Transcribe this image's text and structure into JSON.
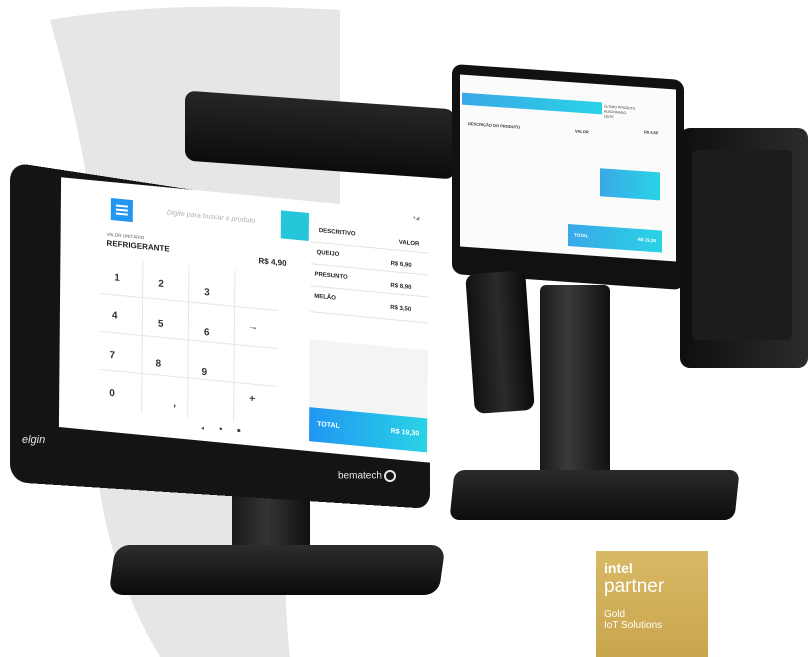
{
  "front_screen": {
    "search_placeholder": "Digite para buscar o produto",
    "unit_value_label": "VALOR UNITÁRIO",
    "product_name": "REFRIGERANTE",
    "product_price": "R$ 4,90",
    "keypad": [
      "1",
      "2",
      "3",
      "4",
      "5",
      "6",
      "7",
      "8",
      "9",
      "0",
      ",",
      "+",
      "→"
    ],
    "columns": {
      "description": "DESCRITIVO",
      "value": "VALOR"
    },
    "items": [
      {
        "name": "QUEIJO",
        "value": "R$ 6,90"
      },
      {
        "name": "PRESUNTO",
        "value": "R$ 8,90"
      },
      {
        "name": "MELÃO",
        "value": "R$ 3,50"
      }
    ],
    "total_label": "TOTAL",
    "total_value": "R$ 19,30",
    "nav": {
      "back": "◂",
      "home": "●",
      "recent": "■"
    }
  },
  "brands": {
    "front_left": "elgin",
    "front_right": "bematech"
  },
  "rear_screen": {
    "header": "DESCRIÇÃO DO PRODUTO",
    "value_header": "VALOR",
    "side_label_1": "ÚLTIMO PRODUTO",
    "side_label_2": "ADICIONADO",
    "side_item": "LEITE",
    "side_value": "R$ 4,50",
    "total_label": "TOTAL",
    "total_value": "R$ 19,30"
  },
  "intel_badge": {
    "brand": "intel",
    "partner": "partner",
    "tier": "Gold",
    "solution": "IoT Solutions"
  },
  "colors": {
    "accent_blue": "#2196f3",
    "accent_cyan": "#29d3e5",
    "intel_gold": "#d2b35e",
    "device_black": "#141414",
    "bg_swoosh": "#e6e6e6"
  }
}
